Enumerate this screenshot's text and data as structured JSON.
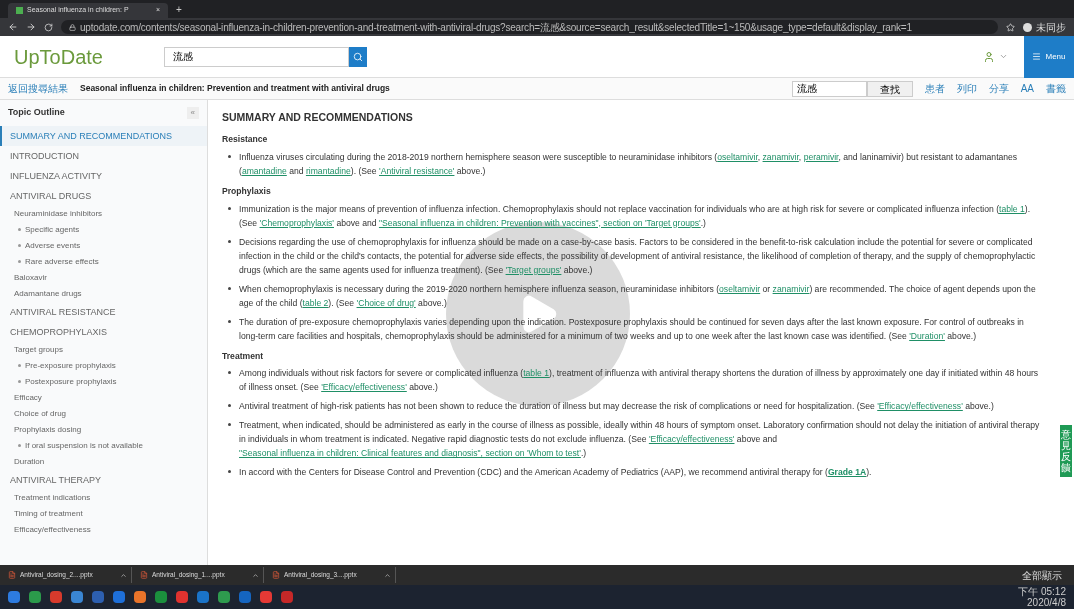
{
  "browser": {
    "tab_title": "Seasonal influenza in children: P",
    "tab_close": "×",
    "new_tab": "+",
    "url": "uptodate.com/contents/seasonal-influenza-in-children-prevention-and-treatment-with-antiviral-drugs?search=流感&source=search_result&selectedTitle=1~150&usage_type=default&display_rank=1",
    "profile": "未同步"
  },
  "header": {
    "logo": "UpToDate",
    "search_value": "流感",
    "menu": "Menu"
  },
  "topic_bar": {
    "back": "返回搜尋結果",
    "title": "Seasonal influenza in children: Prevention and treatment with antiviral drugs",
    "find_value": "流感",
    "find_button": "查找",
    "actions": [
      "患者",
      "列印",
      "分享",
      "AA",
      "書籤"
    ]
  },
  "outline": {
    "title": "Topic Outline",
    "collapse": "«",
    "items": [
      {
        "label": "SUMMARY AND RECOMMENDATIONS",
        "selected": true
      },
      {
        "label": "INTRODUCTION",
        "selected": false
      },
      {
        "label": "INFLUENZA ACTIVITY",
        "selected": false
      },
      {
        "label": "ANTIVIRAL DRUGS",
        "selected": false,
        "children": [
          {
            "label": "Neuraminidase inhibitors",
            "selected": false,
            "children": [
              {
                "label": "Specific agents",
                "selected": false
              },
              {
                "label": "Adverse events",
                "selected": false
              },
              {
                "label": "Rare adverse effects",
                "selected": false
              }
            ]
          },
          {
            "label": "Baloxavir",
            "selected": false
          },
          {
            "label": "Adamantane drugs",
            "selected": false
          }
        ]
      },
      {
        "label": "ANTIVIRAL RESISTANCE",
        "selected": false
      },
      {
        "label": "CHEMOPROPHYLAXIS",
        "selected": false,
        "children": [
          {
            "label": "Target groups",
            "selected": false,
            "children": [
              {
                "label": "Pre-exposure prophylaxis",
                "selected": false
              },
              {
                "label": "Postexposure prophylaxis",
                "selected": false
              }
            ]
          },
          {
            "label": "Efficacy",
            "selected": false
          },
          {
            "label": "Choice of drug",
            "selected": false
          },
          {
            "label": "Prophylaxis dosing",
            "selected": false,
            "children": [
              {
                "label": "If oral suspension is not available",
                "selected": false
              }
            ]
          },
          {
            "label": "Duration",
            "selected": false
          }
        ]
      },
      {
        "label": "ANTIVIRAL THERAPY",
        "selected": false,
        "children": [
          {
            "label": "Treatment indications",
            "selected": false
          },
          {
            "label": "Timing of treatment",
            "selected": false
          },
          {
            "label": "Efficacy/effectiveness",
            "selected": false
          }
        ]
      }
    ]
  },
  "article": {
    "heading": "SUMMARY AND RECOMMENDATIONS",
    "sections": [
      {
        "title": "Resistance",
        "bullets": [
          [
            {
              "t": "Influenza viruses circulating during the 2018-2019 northern hemisphere season were susceptible to neuraminidase inhibitors ("
            },
            {
              "t": "oseltamivir",
              "link": true
            },
            {
              "t": ", "
            },
            {
              "t": "zanamivir",
              "link": true
            },
            {
              "t": ", "
            },
            {
              "t": "peramivir",
              "link": true
            },
            {
              "t": ", and laninamivir) but resistant to adamantanes ("
            },
            {
              "t": "amantadine",
              "link": true
            },
            {
              "t": " and "
            },
            {
              "t": "rimantadine",
              "link": true
            },
            {
              "t": "). (See "
            },
            {
              "t": "'Antiviral resistance'",
              "link": true
            },
            {
              "t": " above.)"
            }
          ]
        ]
      },
      {
        "title": "Prophylaxis",
        "bullets": [
          [
            {
              "t": "Immunization is the major means of prevention of influenza infection. Chemoprophylaxis should not replace vaccination for individuals who are at high risk for severe or complicated influenza infection ("
            },
            {
              "t": "table 1",
              "link": true
            },
            {
              "t": "). (See "
            },
            {
              "t": "'Chemoprophylaxis'",
              "link": true
            },
            {
              "t": " above and "
            },
            {
              "t": "\"Seasonal influenza in children: Prevention with vaccines\", section on 'Target groups'",
              "link": true
            },
            {
              "t": ".)"
            }
          ],
          [
            {
              "t": "Decisions regarding the use of chemoprophylaxis for influenza should be made on a case-by-case basis. Factors to be considered in the benefit-to-risk calculation include the potential for severe or complicated infection in the child or the child's contacts, the potential for adverse side effects, the possibility of development of antiviral resistance, the likelihood of completion of therapy, and the supply of chemoprophylactic drugs (which are the same agents used for influenza treatment). (See "
            },
            {
              "t": "'Target groups'",
              "link": true
            },
            {
              "t": " above.)"
            }
          ],
          [
            {
              "t": "When chemoprophylaxis is necessary during the 2019-2020 northern hemisphere influenza season, neuraminidase inhibitors ("
            },
            {
              "t": "oseltamivir",
              "link": true
            },
            {
              "t": " or "
            },
            {
              "t": "zanamivir",
              "link": true
            },
            {
              "t": ") are recommended. The choice of agent depends upon the age of the child ("
            },
            {
              "t": "table 2",
              "link": true
            },
            {
              "t": "). (See "
            },
            {
              "t": "'Choice of drug'",
              "link": true
            },
            {
              "t": " above.)"
            }
          ],
          [
            {
              "t": "The duration of pre-exposure chemoprophylaxis varies depending upon the indication. Postexposure prophylaxis should be continued for seven days after the last known exposure. For control of outbreaks in long-term care facilities and hospitals, chemoprophylaxis should be administered for a minimum of two weeks and up to one week after the last known case was identified. (See "
            },
            {
              "t": "'Duration'",
              "link": true
            },
            {
              "t": " above.)"
            }
          ]
        ]
      },
      {
        "title": "Treatment",
        "bullets": [
          [
            {
              "t": "Among individuals without risk factors for severe or complicated influenza ("
            },
            {
              "t": "table 1",
              "link": true
            },
            {
              "t": "), treatment of influenza with antiviral therapy shortens the duration of illness by approximately one day if initiated within 48 hours of illness onset. (See "
            },
            {
              "t": "'Efficacy/effectiveness'",
              "link": true
            },
            {
              "t": " above.)"
            }
          ],
          [
            {
              "t": "Antiviral treatment of high-risk patients has not been shown to reduce the duration of illness but may decrease the risk of complications or need for hospitalization. (See "
            },
            {
              "t": "'Efficacy/effectiveness'",
              "link": true
            },
            {
              "t": " above.)"
            }
          ],
          [
            {
              "t": "Treatment, when indicated, should be administered as early in the course of illness as possible, ideally within 48 hours of symptom onset. Laboratory confirmation should not delay the initiation of antiviral therapy in individuals in whom treatment is indicated. Negative rapid diagnostic tests do not exclude influenza. (See "
            },
            {
              "t": "'Efficacy/effectiveness'",
              "link": true
            },
            {
              "t": " above and "
            },
            {
              "t": "\"Seasonal influenza in children: Clinical features and diagnosis\", section on 'Whom to test'",
              "link": true
            },
            {
              "t": ".)"
            }
          ],
          [
            {
              "t": "In accord with the Centers for Disease Control and Prevention (CDC) and the American Academy of Pediatrics (AAP), we recommend antiviral therapy for ("
            },
            {
              "t": "Grade 1A",
              "link": true,
              "bold": true
            },
            {
              "t": ")."
            }
          ]
        ]
      }
    ]
  },
  "feedback_tab": "意見反饋",
  "downloads": {
    "files": [
      "Antiviral_dosing_2....pptx",
      "Antiviral_dosing_1....pptx",
      "Antiviral_dosing_3....pptx"
    ],
    "show_all": "全部顯示"
  },
  "taskbar": {
    "time": "下午 05:12",
    "date": "2020/4/8"
  }
}
